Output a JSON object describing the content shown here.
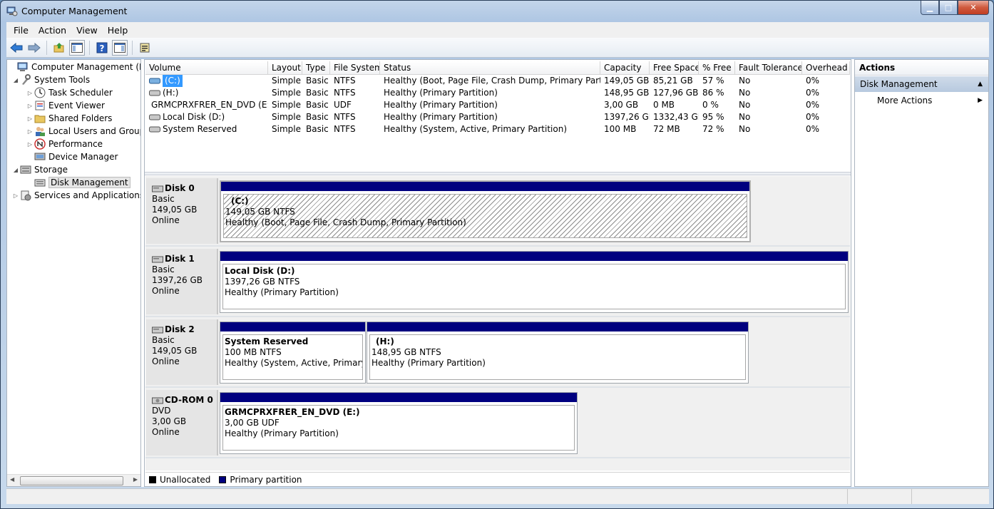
{
  "window": {
    "title": "Computer Management"
  },
  "menu": [
    "File",
    "Action",
    "View",
    "Help"
  ],
  "tree": [
    {
      "label": "Computer Management (Local",
      "level": 0,
      "expander": "",
      "icon": "computer-icon"
    },
    {
      "label": "System Tools",
      "level": 1,
      "expander": "◢",
      "icon": "tools-icon"
    },
    {
      "label": "Task Scheduler",
      "level": 2,
      "expander": "▷",
      "icon": "clock-icon"
    },
    {
      "label": "Event Viewer",
      "level": 2,
      "expander": "▷",
      "icon": "event-viewer-icon"
    },
    {
      "label": "Shared Folders",
      "level": 2,
      "expander": "▷",
      "icon": "folder-icon"
    },
    {
      "label": "Local Users and Groups",
      "level": 2,
      "expander": "▷",
      "icon": "users-icon"
    },
    {
      "label": "Performance",
      "level": 2,
      "expander": "▷",
      "icon": "performance-icon"
    },
    {
      "label": "Device Manager",
      "level": 2,
      "expander": "",
      "icon": "device-manager-icon"
    },
    {
      "label": "Storage",
      "level": 1,
      "expander": "◢",
      "icon": "storage-icon"
    },
    {
      "label": "Disk Management",
      "level": 2,
      "expander": "",
      "icon": "disk-management-icon"
    },
    {
      "label": "Services and Applications",
      "level": 1,
      "expander": "▷",
      "icon": "services-icon"
    }
  ],
  "volume_table": {
    "columns": [
      "Volume",
      "Layout",
      "Type",
      "File System",
      "Status",
      "Capacity",
      "Free Space",
      "% Free",
      "Fault Tolerance",
      "Overhead"
    ],
    "rows": [
      [
        "(C:)",
        "Simple",
        "Basic",
        "NTFS",
        "Healthy (Boot, Page File, Crash Dump, Primary Partition)",
        "149,05 GB",
        "85,21 GB",
        "57 %",
        "No",
        "0%"
      ],
      [
        "(H:)",
        "Simple",
        "Basic",
        "NTFS",
        "Healthy (Primary Partition)",
        "148,95 GB",
        "127,96 GB",
        "86 %",
        "No",
        "0%"
      ],
      [
        "GRMCPRXFRER_EN_DVD (E:)",
        "Simple",
        "Basic",
        "UDF",
        "Healthy (Primary Partition)",
        "3,00 GB",
        "0 MB",
        "0 %",
        "No",
        "0%"
      ],
      [
        "Local Disk (D:)",
        "Simple",
        "Basic",
        "NTFS",
        "Healthy (Primary Partition)",
        "1397,26 GB",
        "1332,43 GB",
        "95 %",
        "No",
        "0%"
      ],
      [
        "System Reserved",
        "Simple",
        "Basic",
        "NTFS",
        "Healthy (System, Active, Primary Partition)",
        "100 MB",
        "72 MB",
        "72 %",
        "No",
        "0%"
      ]
    ]
  },
  "disks": [
    {
      "name": "Disk 0",
      "type": "Basic",
      "size": "149,05 GB",
      "status": "Online",
      "partitions": [
        {
          "name": "(C:)",
          "size": "149,05 GB NTFS",
          "status": "Healthy (Boot, Page File, Crash Dump, Primary Partition)"
        }
      ]
    },
    {
      "name": "Disk 1",
      "type": "Basic",
      "size": "1397,26 GB",
      "status": "Online",
      "partitions": [
        {
          "name": "Local Disk  (D:)",
          "size": "1397,26 GB NTFS",
          "status": "Healthy (Primary Partition)"
        }
      ]
    },
    {
      "name": "Disk 2",
      "type": "Basic",
      "size": "149,05 GB",
      "status": "Online",
      "partitions": [
        {
          "name": "System Reserved",
          "size": "100 MB NTFS",
          "status": "Healthy (System, Active, Primary Partition)"
        },
        {
          "name": "(H:)",
          "size": "148,95 GB NTFS",
          "status": "Healthy (Primary Partition)"
        }
      ]
    },
    {
      "name": "CD-ROM 0",
      "type": "DVD",
      "size": "3,00 GB",
      "status": "Online",
      "partitions": [
        {
          "name": "GRMCPRXFRER_EN_DVD  (E:)",
          "size": "3,00 GB UDF",
          "status": "Healthy (Primary Partition)"
        }
      ]
    }
  ],
  "legend": [
    {
      "label": "Unallocated",
      "color": "#000000"
    },
    {
      "label": "Primary partition",
      "color": "#00007f"
    }
  ],
  "actions": {
    "header": "Actions",
    "section": "Disk Management",
    "item": "More Actions"
  },
  "colors": {
    "primary_partition": "#00007f",
    "selection": "#3399ff"
  }
}
